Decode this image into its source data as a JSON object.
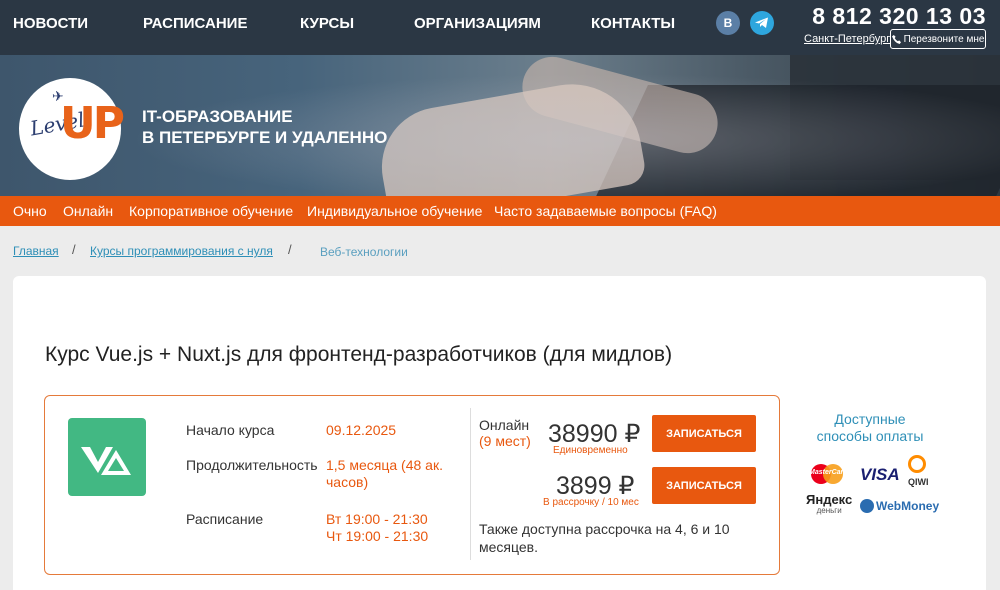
{
  "topnav": [
    "НОВОСТИ",
    "РАСПИСАНИЕ",
    "КУРСЫ",
    "ОРГАНИЗАЦИЯМ",
    "КОНТАКТЫ"
  ],
  "social": {
    "vk": "B"
  },
  "phone": "8 812 320 13 03",
  "city": "Санкт-Петербург",
  "callback": "Перезвоните мне",
  "logo": {
    "level": "Level",
    "up": "UP"
  },
  "hero_title": [
    "IT-ОБРАЗОВАНИЕ",
    "В ПЕТЕРБУРГЕ И УДАЛЕННО"
  ],
  "orange_nav": [
    "Очно",
    "Онлайн",
    "Корпоративное обучение",
    "Индивидуальное обучение",
    "Часто задаваемые вопросы (FAQ)"
  ],
  "breadcrumb": {
    "home": "Главная",
    "courses": "Курсы программирования с нуля",
    "current": "Веб-технологии",
    "sep": "/"
  },
  "course": {
    "title": "Курс Vue.js + Nuxt.js для фронтенд-разработчиков (для мидлов)",
    "start_label": "Начало курса",
    "start_value": "09.12.2025",
    "duration_label": "Продолжительность",
    "duration_value": [
      "1,5 месяца (48 ак.",
      "часов)"
    ],
    "schedule_label": "Расписание",
    "schedule_value": [
      "Вт 19:00 - 21:30",
      "Чт 19:00 - 21:30"
    ],
    "mode": "Онлайн",
    "mode_period": "(9 мест)",
    "price_full": "38990 ₽",
    "price_full_note": "Единовременно",
    "price_installment": "3899 ₽",
    "price_installment_note": "В рассрочку / 10 мес",
    "enroll_label": "ЗАПИСАТЬСЯ",
    "installment_text": "Также доступна рассрочка на 4, 6 и 10 месяцев."
  },
  "payment": {
    "title": "Доступные способы оплаты",
    "methods": [
      "MasterCard",
      "VISA",
      "QIWI",
      "Яндекс",
      "деньги",
      "WebMoney"
    ]
  },
  "colors": {
    "accent": "#e8580f",
    "topbar": "#2b3744",
    "link": "#2e8fb7",
    "vue": "#42b883"
  }
}
